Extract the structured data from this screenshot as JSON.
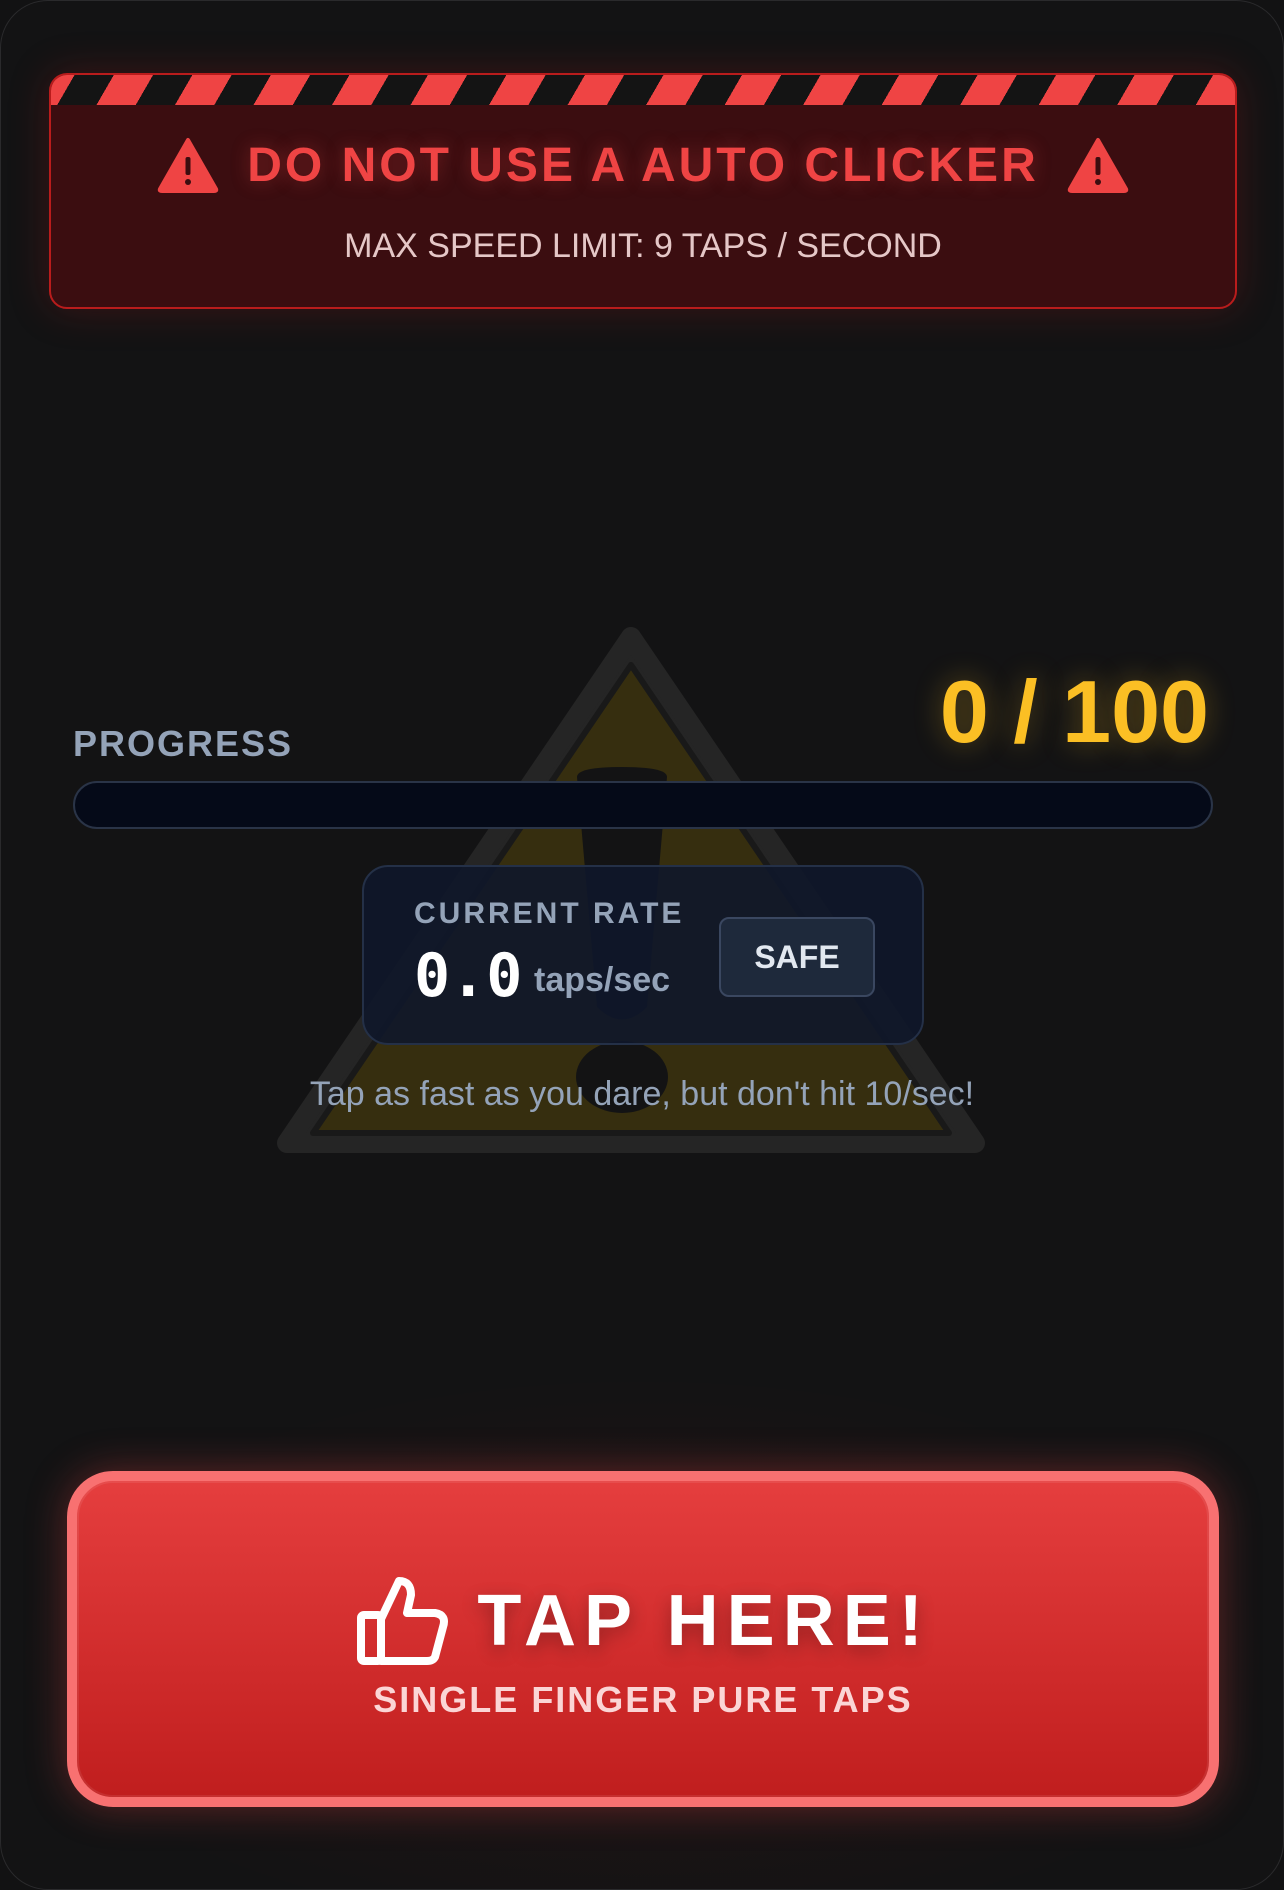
{
  "banner": {
    "title": "DO NOT USE A AUTO CLICKER",
    "subtitle": "MAX SPEED LIMIT: 9 TAPS / SECOND"
  },
  "progress": {
    "label": "PROGRESS",
    "counter": "0 / 100",
    "current": 0,
    "max": 100
  },
  "rate": {
    "label": "CURRENT RATE",
    "value": "0.0",
    "unit": "taps/sec",
    "status": "SAFE"
  },
  "hint": "Tap as fast as you dare, but don't hit 10/sec!",
  "tap_button": {
    "title": "TAP HERE!",
    "subtitle": "SINGLE FINGER PURE TAPS"
  },
  "colors": {
    "danger": "#ef4444",
    "accent": "#fbbf24",
    "panel": "#0f172a"
  }
}
